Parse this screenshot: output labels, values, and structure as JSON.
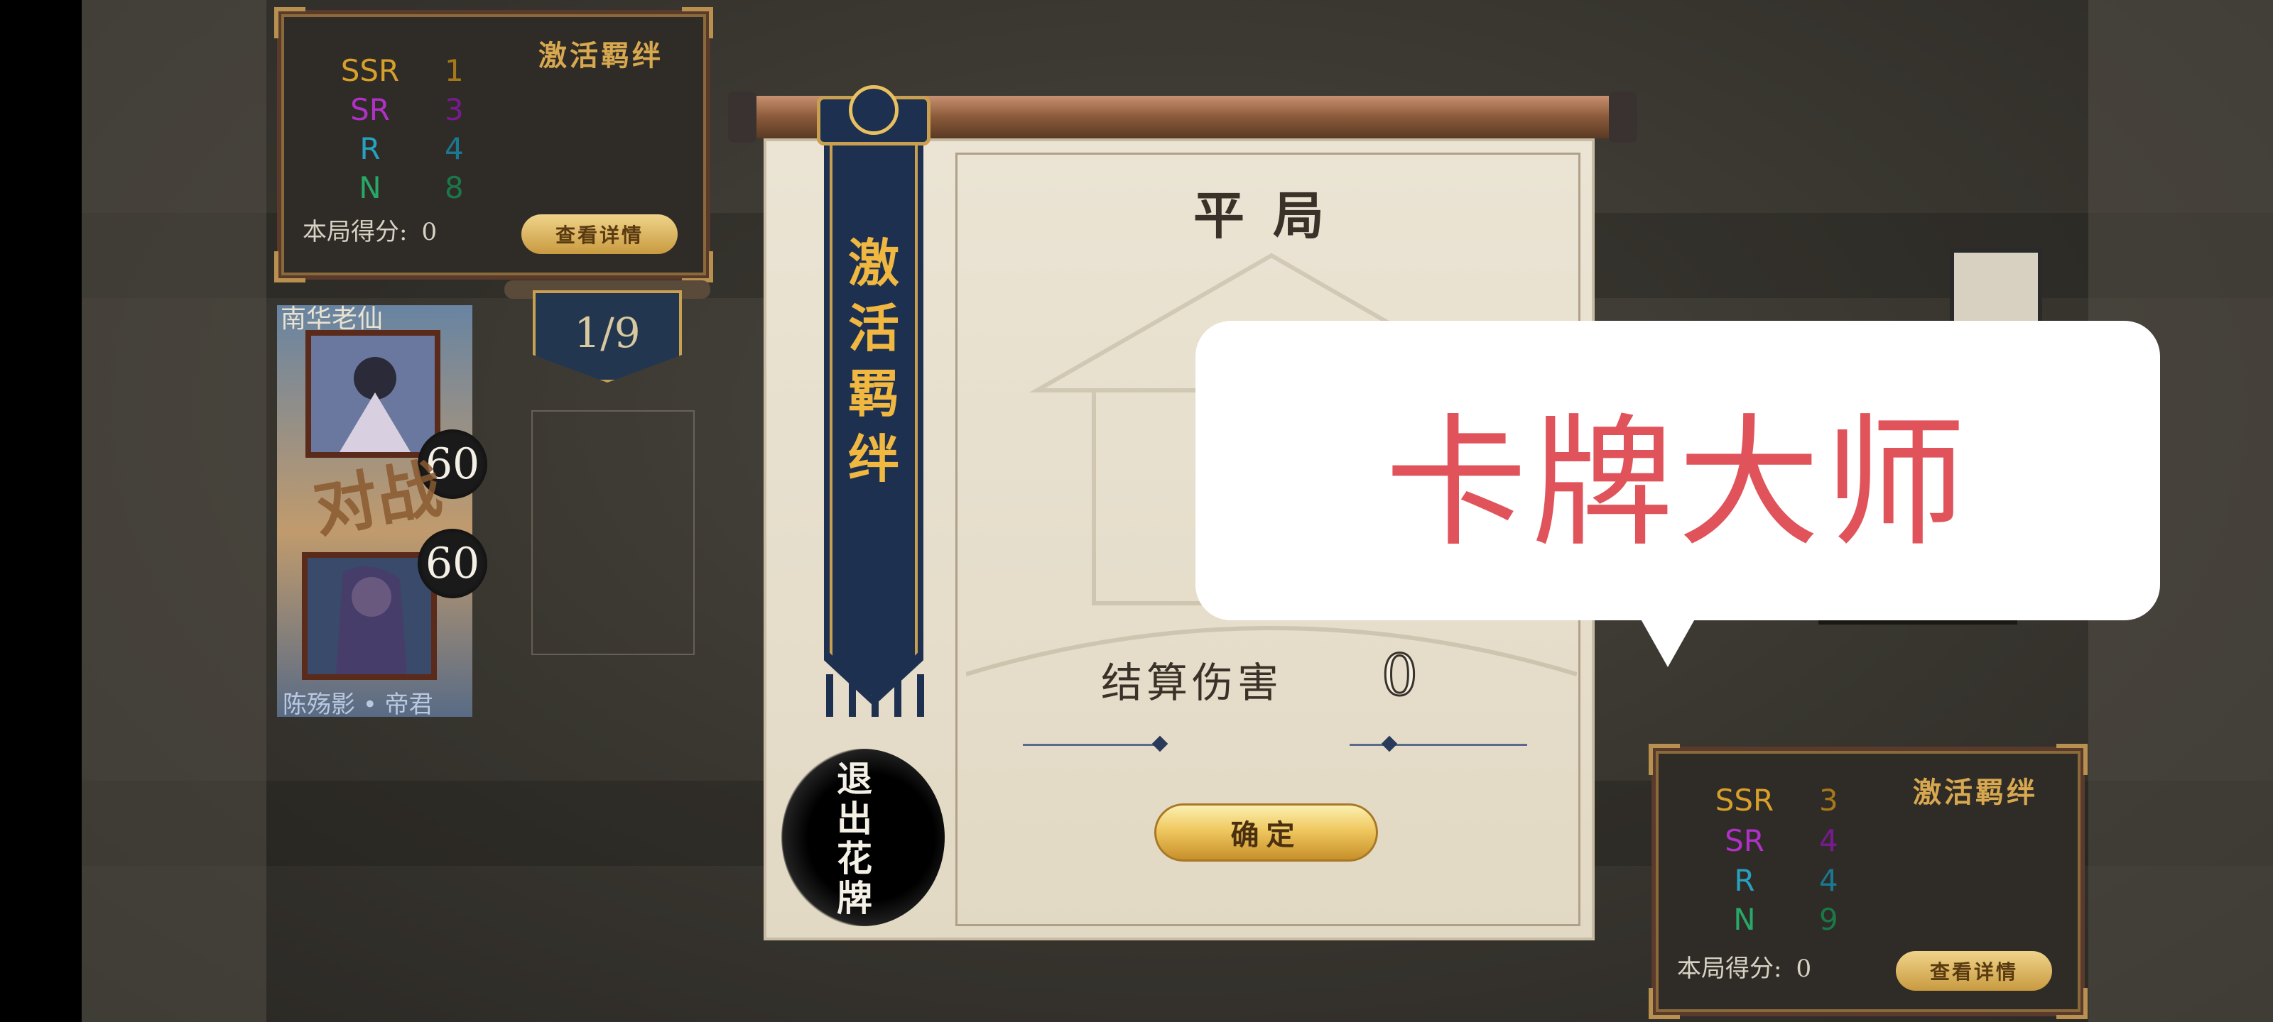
{
  "top_score": {
    "title": "激活羁绊",
    "rarities": [
      {
        "label": "SSR",
        "count": "1"
      },
      {
        "label": "SR",
        "count": "3"
      },
      {
        "label": "R",
        "count": "4"
      },
      {
        "label": "N",
        "count": "8"
      }
    ],
    "score_label": "本局得分:",
    "score_value": "0",
    "detail_label": "查看详情"
  },
  "bottom_score": {
    "title": "激活羁绊",
    "rarities": [
      {
        "label": "SSR",
        "count": "3"
      },
      {
        "label": "SR",
        "count": "4"
      },
      {
        "label": "R",
        "count": "4"
      },
      {
        "label": "N",
        "count": "9"
      }
    ],
    "score_label": "本局得分:",
    "score_value": "0",
    "detail_label": "查看详情"
  },
  "players": {
    "top_name": "南华老仙",
    "top_hp": "60",
    "bottom_name": "陈殇影 • 帝君",
    "bottom_hp": "60",
    "vs_label": "对战"
  },
  "round": "1/9",
  "banner_text": [
    "激",
    "活",
    "羁",
    "绊"
  ],
  "result": {
    "title": "平局",
    "damage_label": "结算伤害",
    "damage_value": "0",
    "confirm_label": "确定"
  },
  "exit_label": [
    "退",
    "出",
    "花",
    "牌"
  ],
  "brand_overlay": "卡牌大师"
}
